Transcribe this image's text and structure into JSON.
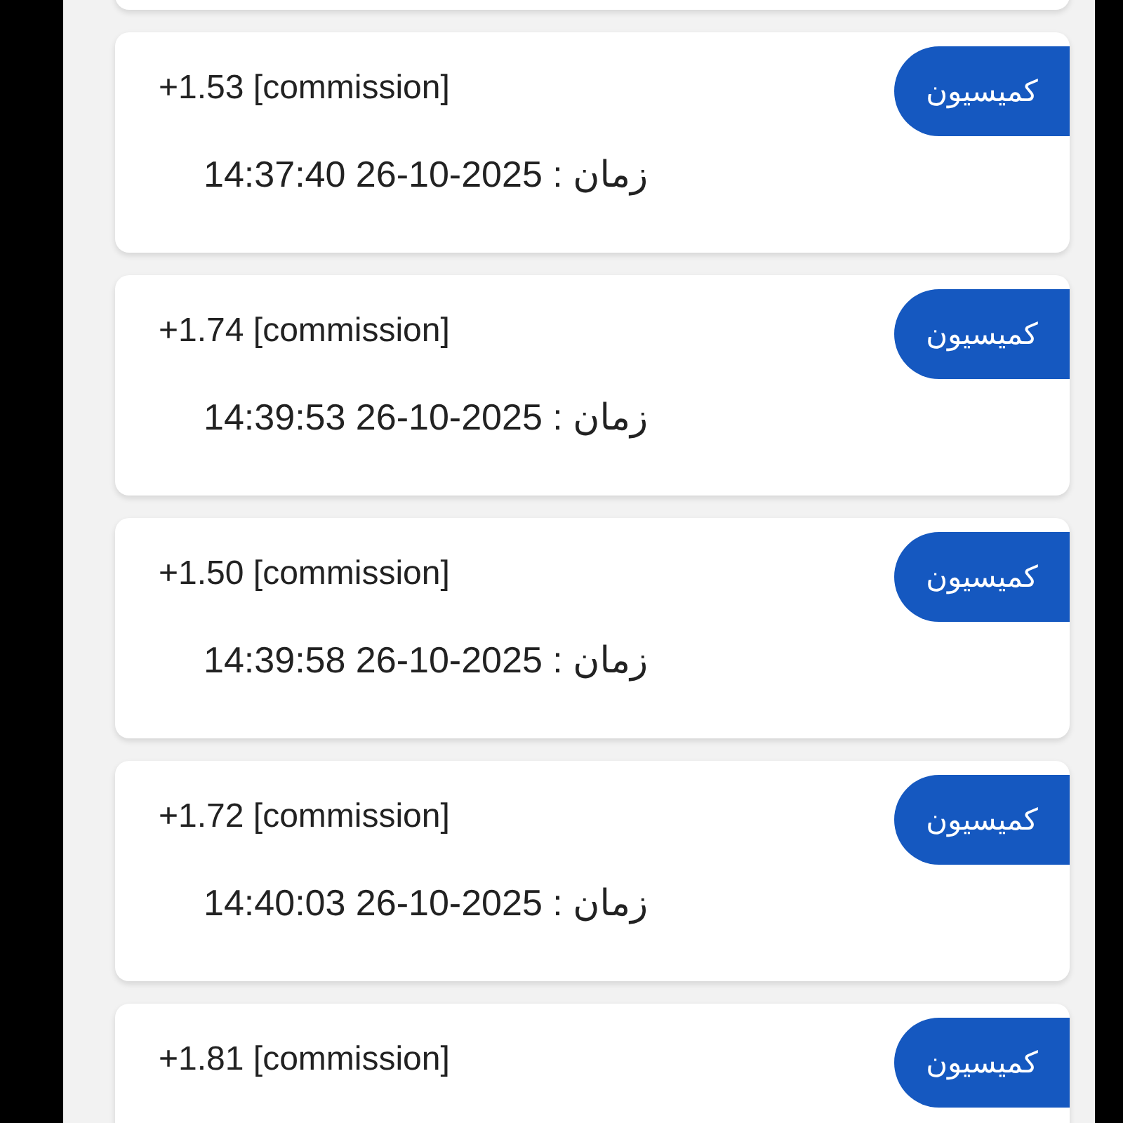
{
  "entries": [
    {
      "amount": "+1.53 [commission]",
      "time": "14:37:40 26-10-2025 : زمان",
      "tag": "کمیسیون"
    },
    {
      "amount": "+1.74 [commission]",
      "time": "14:39:53 26-10-2025 : زمان",
      "tag": "کمیسیون"
    },
    {
      "amount": "+1.50 [commission]",
      "time": "14:39:58 26-10-2025 : زمان",
      "tag": "کمیسیون"
    },
    {
      "amount": "+1.72 [commission]",
      "time": "14:40:03 26-10-2025 : زمان",
      "tag": "کمیسیون"
    },
    {
      "amount": "+1.81 [commission]",
      "tag": "کمیسیون"
    }
  ]
}
